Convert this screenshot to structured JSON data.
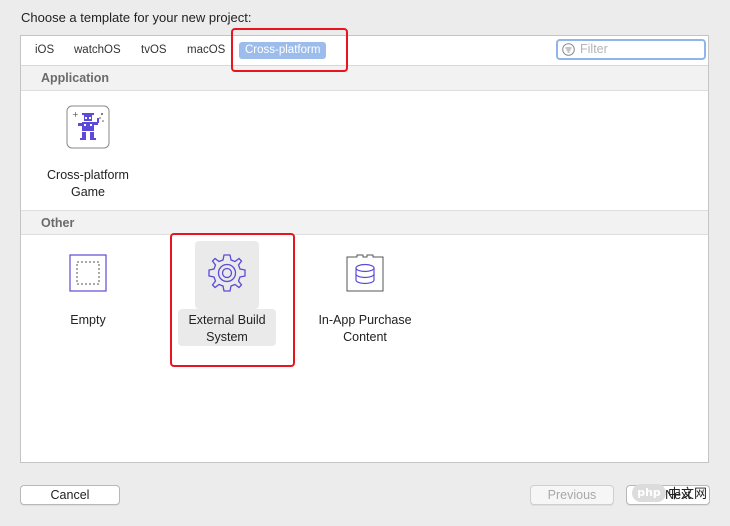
{
  "prompt": "Choose a template for your new project:",
  "tabs": [
    {
      "label": "iOS",
      "active": false
    },
    {
      "label": "watchOS",
      "active": false
    },
    {
      "label": "tvOS",
      "active": false
    },
    {
      "label": "macOS",
      "active": false
    },
    {
      "label": "Cross-platform",
      "active": true
    }
  ],
  "filter": {
    "placeholder": "Filter",
    "icon": "filter-icon"
  },
  "sections": [
    {
      "title": "Application",
      "items": [
        {
          "label_line1": "Cross-platform",
          "label_line2": "Game",
          "icon": "game-icon",
          "selected": false
        }
      ]
    },
    {
      "title": "Other",
      "items": [
        {
          "label_line1": "Empty",
          "label_line2": "",
          "icon": "empty-icon",
          "selected": false
        },
        {
          "label_line1": "External Build",
          "label_line2": "System",
          "icon": "gear-icon",
          "selected": true
        },
        {
          "label_line1": "In-App Purchase",
          "label_line2": "Content",
          "icon": "in-app-purchase-icon",
          "selected": false
        }
      ]
    }
  ],
  "buttons": {
    "cancel": "Cancel",
    "previous": "Previous",
    "next": "Next"
  },
  "watermark": {
    "logo": "php",
    "text": "中文网"
  },
  "colors": {
    "accent": "#9cbcec",
    "filter_border": "#8fb5ea",
    "annotation_red": "#e8141e",
    "icon_purple": "#5b4bd6"
  }
}
